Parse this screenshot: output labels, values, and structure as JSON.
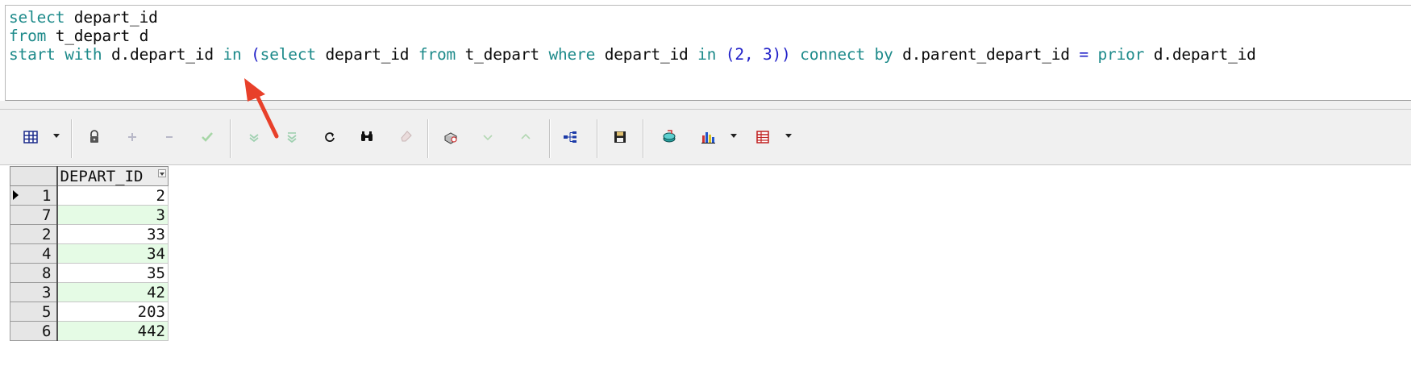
{
  "editor": {
    "line1": {
      "kw_select": "select",
      "id_col": " depart_id"
    },
    "line2": {
      "kw_from": "from",
      "id_table": " t_depart d"
    },
    "line3": {
      "kw_start": "start",
      "kw_with": "with",
      "id_d_col": "d.depart_id",
      "kw_in": "in",
      "paren_open": "(",
      "kw_select": "select",
      "id_col": "depart_id",
      "kw_from": "from",
      "id_table": "t_depart",
      "kw_where": "where",
      "id_col2": "depart_id",
      "kw_in2": "in",
      "paren2_open": "(",
      "num_2": "2",
      "comma": ",",
      "num_3": "3",
      "paren_close": "))",
      "kw_connect": "connect",
      "kw_by": "by",
      "id_parent": "d.parent_depart_id",
      "op_eq": "=",
      "kw_prior": "prior",
      "id_depart": "d.depart_id"
    }
  },
  "toolbar": {
    "icons": [
      "grid-view-icon",
      "lock-icon",
      "add-record-icon",
      "remove-record-icon",
      "post-check-icon",
      "fetch-next-page-icon",
      "fetch-last-page-icon",
      "refresh-icon",
      "find-icon",
      "clear-icon",
      "query-by-example-icon",
      "next-record-icon",
      "previous-record-icon",
      "tree-icon",
      "save-icon",
      "export-icon",
      "chart-icon",
      "single-record-view-icon"
    ]
  },
  "grid": {
    "column": "DEPART_ID",
    "rows": [
      {
        "num": "1",
        "value": "2"
      },
      {
        "num": "7",
        "value": "3"
      },
      {
        "num": "2",
        "value": "33"
      },
      {
        "num": "4",
        "value": "34"
      },
      {
        "num": "8",
        "value": "35"
      },
      {
        "num": "3",
        "value": "42"
      },
      {
        "num": "5",
        "value": "203"
      },
      {
        "num": "6",
        "value": "442"
      }
    ]
  },
  "colors": {
    "keyword": "#1d8a8a",
    "number": "#2020c8",
    "alt_row": "#e5fbe5",
    "annotation": "#e8402a"
  }
}
